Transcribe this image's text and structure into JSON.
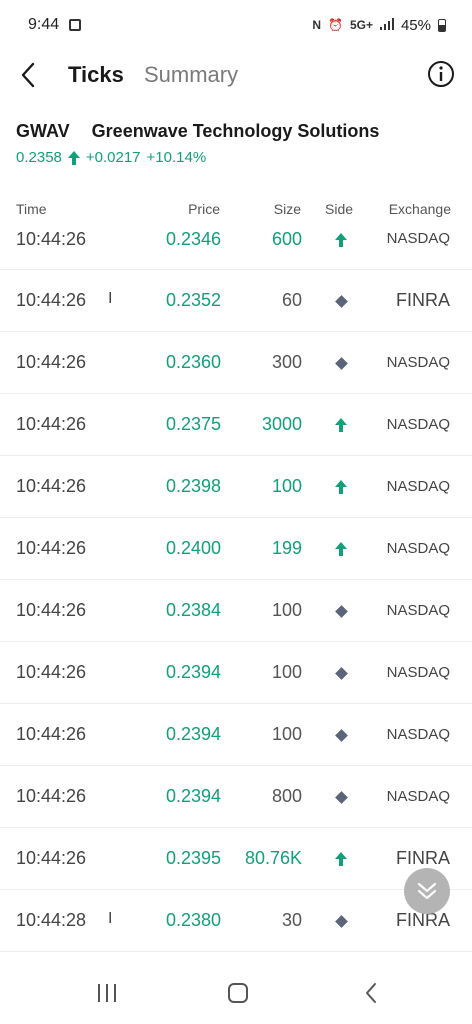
{
  "status_bar": {
    "time": "9:44",
    "network": "5G+",
    "battery": "45%"
  },
  "header": {
    "tabs": [
      {
        "label": "Ticks",
        "active": true
      },
      {
        "label": "Summary",
        "active": false
      }
    ]
  },
  "stock": {
    "ticker": "GWAV",
    "name": "Greenwave Technology Solutions",
    "price": "0.2358",
    "change": "+0.0217",
    "change_pct": "+10.14%"
  },
  "columns": {
    "time": "Time",
    "price": "Price",
    "size": "Size",
    "side": "Side",
    "exchange": "Exchange"
  },
  "ticks": [
    {
      "time": "10:44:26",
      "cond": "",
      "price": "0.2346",
      "size": "600",
      "side": "up",
      "exchange": "NASDAQ"
    },
    {
      "time": "10:44:26",
      "cond": "I",
      "price": "0.2352",
      "size": "60",
      "side": "neutral",
      "exchange": "FINRA"
    },
    {
      "time": "10:44:26",
      "cond": "",
      "price": "0.2360",
      "size": "300",
      "side": "neutral",
      "exchange": "NASDAQ"
    },
    {
      "time": "10:44:26",
      "cond": "",
      "price": "0.2375",
      "size": "3000",
      "side": "up",
      "exchange": "NASDAQ"
    },
    {
      "time": "10:44:26",
      "cond": "",
      "price": "0.2398",
      "size": "100",
      "side": "up",
      "exchange": "NASDAQ"
    },
    {
      "time": "10:44:26",
      "cond": "",
      "price": "0.2400",
      "size": "199",
      "side": "up",
      "exchange": "NASDAQ"
    },
    {
      "time": "10:44:26",
      "cond": "",
      "price": "0.2384",
      "size": "100",
      "side": "neutral",
      "exchange": "NASDAQ"
    },
    {
      "time": "10:44:26",
      "cond": "",
      "price": "0.2394",
      "size": "100",
      "side": "neutral",
      "exchange": "NASDAQ"
    },
    {
      "time": "10:44:26",
      "cond": "",
      "price": "0.2394",
      "size": "100",
      "side": "neutral",
      "exchange": "NASDAQ"
    },
    {
      "time": "10:44:26",
      "cond": "",
      "price": "0.2394",
      "size": "800",
      "side": "neutral",
      "exchange": "NASDAQ"
    },
    {
      "time": "10:44:26",
      "cond": "",
      "price": "0.2395",
      "size": "80.76K",
      "side": "up",
      "exchange": "FINRA"
    },
    {
      "time": "10:44:28",
      "cond": "I",
      "price": "0.2380",
      "size": "30",
      "side": "neutral",
      "exchange": "FINRA"
    }
  ],
  "colors": {
    "up": "#12a07a",
    "neutral": "#5b6478"
  }
}
